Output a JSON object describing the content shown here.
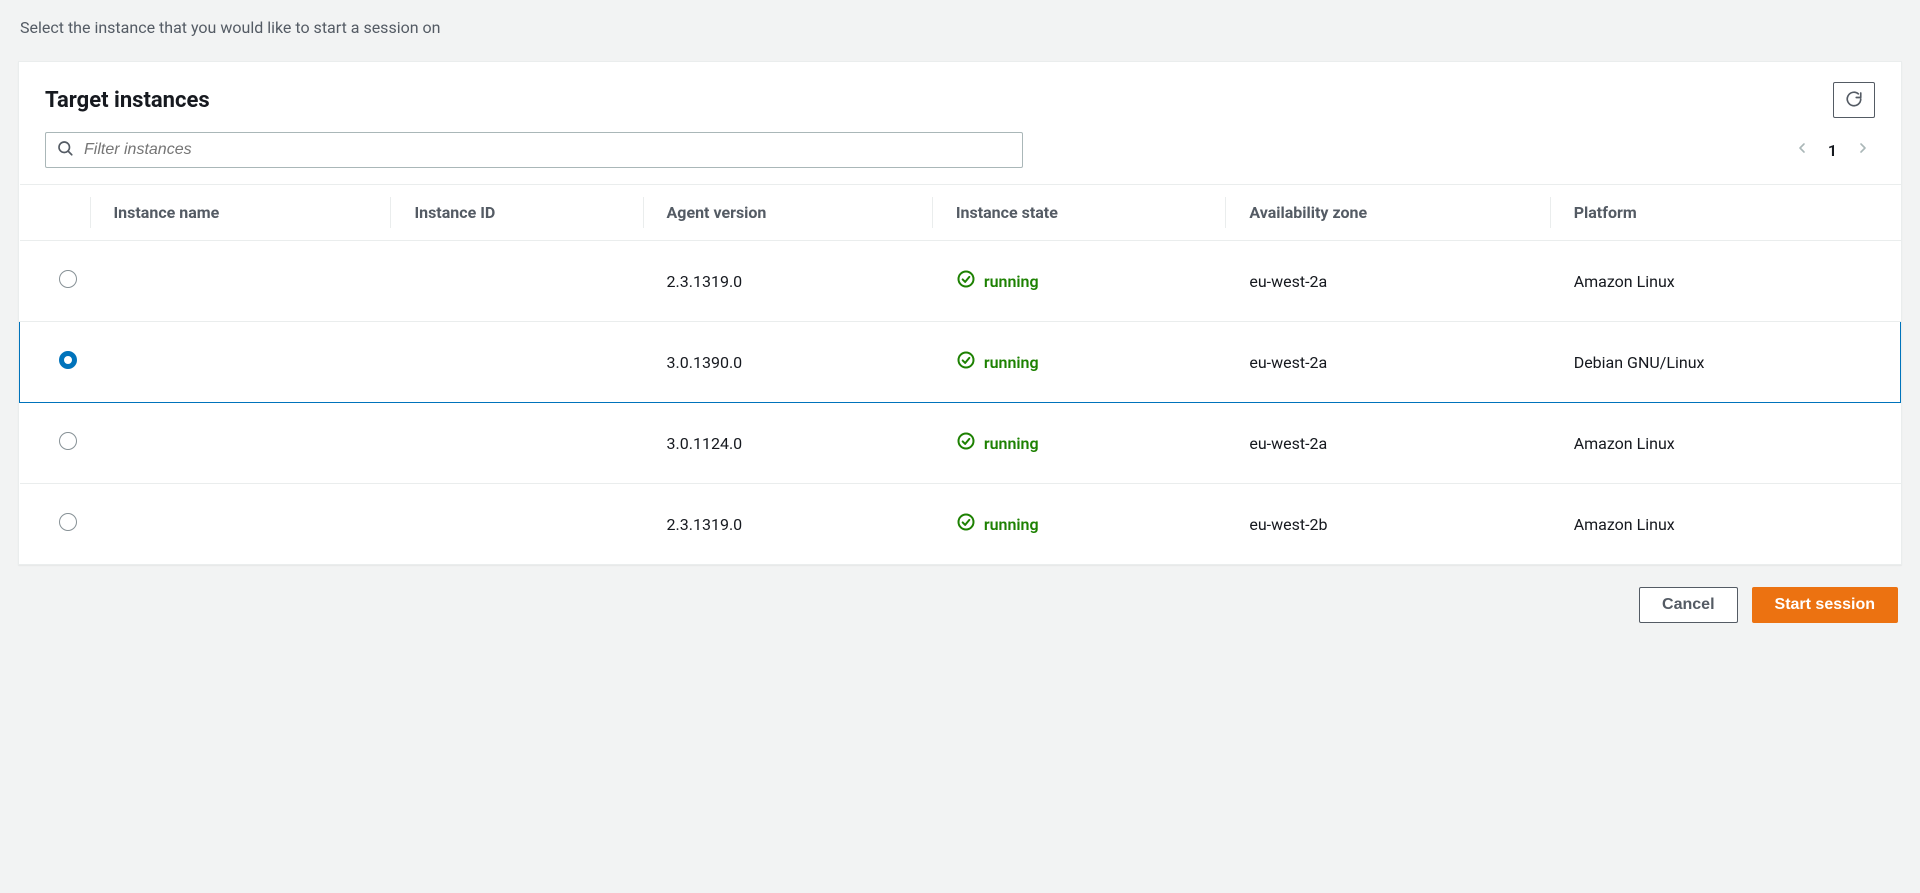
{
  "page": {
    "subtitle": "Select the instance that you would like to start a session on"
  },
  "panel": {
    "title": "Target instances",
    "filter_placeholder": "Filter instances",
    "page_number": "1"
  },
  "columns": {
    "instance_name": "Instance name",
    "instance_id": "Instance ID",
    "agent_version": "Agent version",
    "instance_state": "Instance state",
    "availability_zone": "Availability zone",
    "platform": "Platform"
  },
  "rows": [
    {
      "selected": false,
      "instance_name": "",
      "instance_id": "",
      "agent_version": "2.3.1319.0",
      "instance_state": "running",
      "availability_zone": "eu-west-2a",
      "platform": "Amazon Linux"
    },
    {
      "selected": true,
      "instance_name": "",
      "instance_id": "",
      "agent_version": "3.0.1390.0",
      "instance_state": "running",
      "availability_zone": "eu-west-2a",
      "platform": "Debian GNU/Linux"
    },
    {
      "selected": false,
      "instance_name": "",
      "instance_id": "",
      "agent_version": "3.0.1124.0",
      "instance_state": "running",
      "availability_zone": "eu-west-2a",
      "platform": "Amazon Linux"
    },
    {
      "selected": false,
      "instance_name": "",
      "instance_id": "",
      "agent_version": "2.3.1319.0",
      "instance_state": "running",
      "availability_zone": "eu-west-2b",
      "platform": "Amazon Linux"
    }
  ],
  "footer": {
    "cancel": "Cancel",
    "start_session": "Start session"
  }
}
